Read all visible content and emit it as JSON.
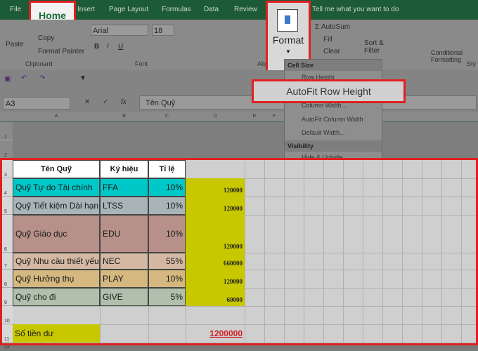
{
  "ribbon_tabs": [
    "File",
    "Home",
    "Insert",
    "Page Layout",
    "Formulas",
    "Data",
    "Review",
    "Tell me what you want to do"
  ],
  "active_tab": "Home",
  "clipboard": {
    "paste": "Paste",
    "copy": "Copy",
    "format_painter": "Format Painter",
    "group": "Clipboard"
  },
  "font": {
    "name": "Arial",
    "size": "18",
    "bold": "B",
    "italic": "I",
    "underline": "U",
    "group": "Font"
  },
  "alignment_group": "Alignm",
  "format_button": "Format",
  "editing": {
    "autosum": "AutoSum",
    "fill": "Fill",
    "clear": "Clear",
    "sort_filter": "Sort & Filter",
    "number_group": "ber"
  },
  "styles": {
    "conditional": "Conditional Formatting",
    "group": "Sty"
  },
  "formula_bar": {
    "name_box": "A3",
    "fx": "fx",
    "value": "Tên Quỹ"
  },
  "columns": [
    "A",
    "B",
    "C",
    "D",
    "E",
    "F"
  ],
  "format_menu": {
    "cell_size": "Cell Size",
    "row_height": "Row Height",
    "autofit_row": "AutoFit Row Height",
    "column_width": "Column Width...",
    "autofit_col": "AutoFit Column Width",
    "default_width": "Default Width...",
    "visibility": "Visibility",
    "hide_unhide": "Hide & Unhide"
  },
  "table": {
    "headers": [
      "Tên Quỹ",
      "Ký hiệu",
      "Tỉ lệ"
    ],
    "rows": [
      {
        "name": "Quỹ Tự do Tài chính",
        "code": "FFA",
        "rate": "10%",
        "amount": "120000",
        "color": "#00c8c8"
      },
      {
        "name": "Quỹ Tiết kiệm Dài hạn",
        "code": "LTSS",
        "rate": "10%",
        "amount": "120000",
        "color": "#a8b4b8"
      },
      {
        "name": "Quỹ Giáo dục",
        "code": "EDU",
        "rate": "10%",
        "amount": "120000",
        "color": "#b8908a"
      },
      {
        "name": "Quỹ Nhu cầu thiết yếu",
        "code": "NEC",
        "rate": "55%",
        "amount": "660000",
        "color": "#d4b8a4"
      },
      {
        "name": "Quỹ Hưởng thụ",
        "code": "PLAY",
        "rate": "10%",
        "amount": "120000",
        "color": "#d4b880"
      },
      {
        "name": "Quỹ cho đi",
        "code": "GIVE",
        "rate": "5%",
        "amount": "60000",
        "color": "#b0c0ac"
      }
    ],
    "balance_label": "Số tiền dư",
    "balance_value": "1200000",
    "amount_fill": "#c8c800"
  },
  "row_numbers": [
    "1",
    "2",
    "3",
    "4",
    "5",
    "6",
    "7",
    "8",
    "9",
    "10",
    "11",
    "12"
  ]
}
